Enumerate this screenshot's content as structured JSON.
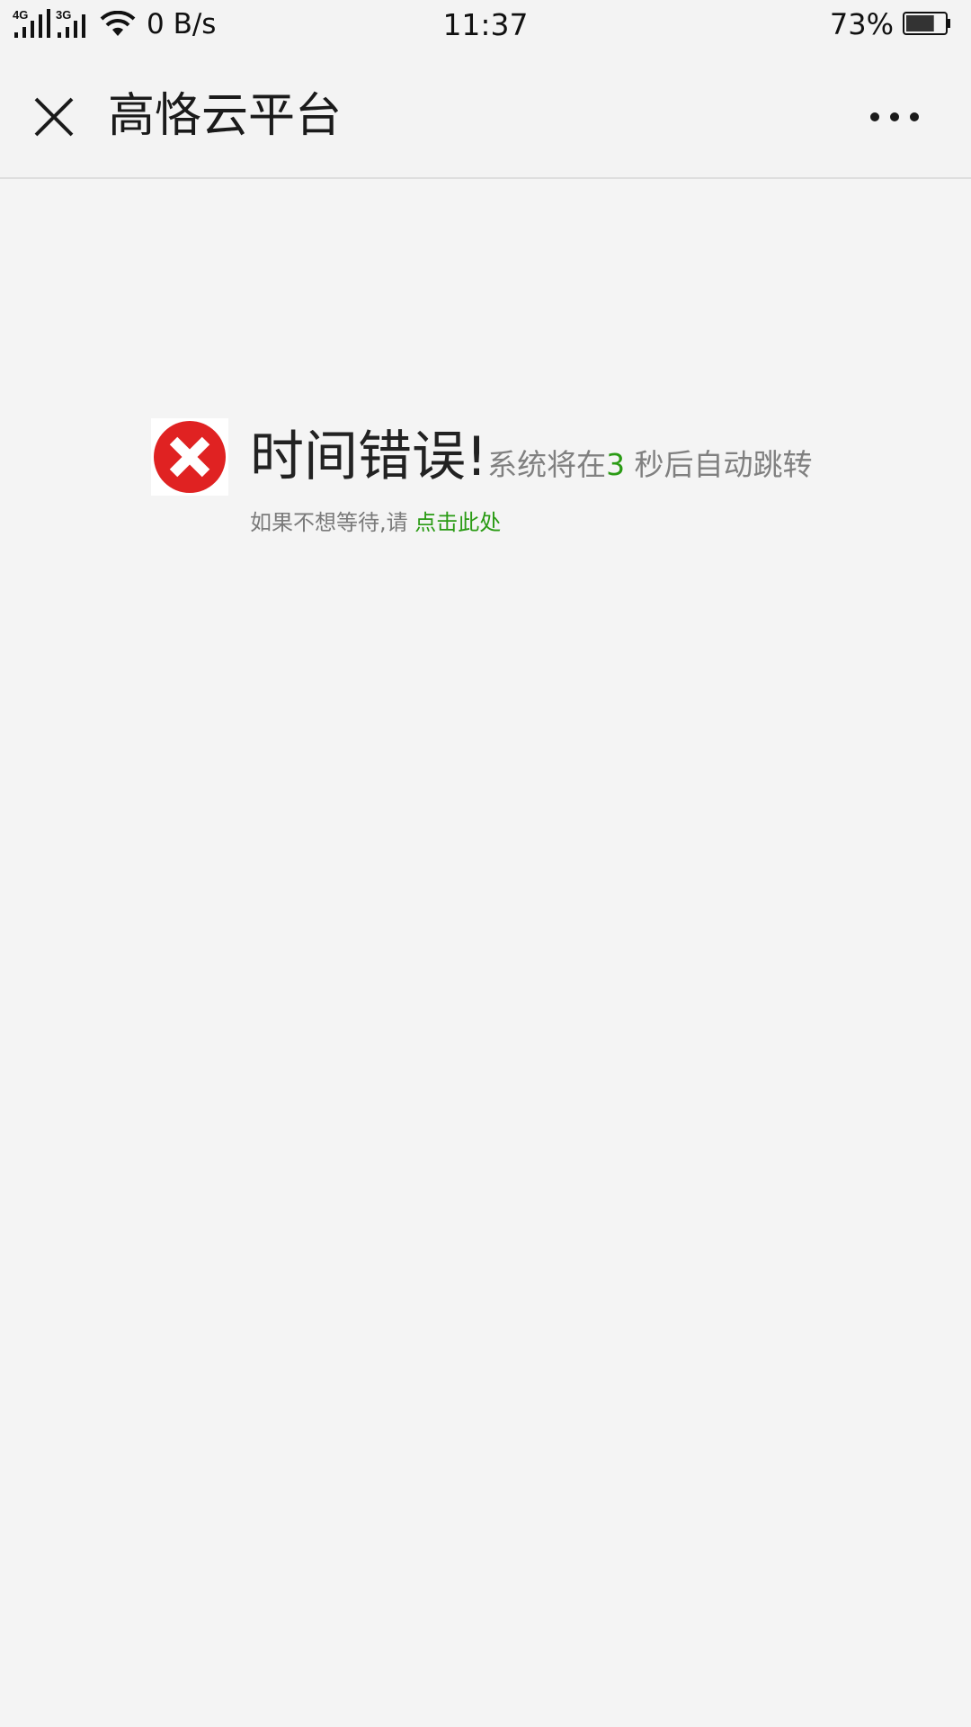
{
  "status_bar": {
    "network_label_1": "4G",
    "network_label_2": "3G",
    "net_speed": "0 B/s",
    "time": "11:37",
    "battery_percent": "73%",
    "battery_level": 0.73
  },
  "nav": {
    "title": "高恪云平台",
    "close_icon": "close-icon",
    "more_icon": "more-icon"
  },
  "content": {
    "icon": "error-x-icon",
    "error_title": "时间错误!",
    "sub_prefix": "系统将在",
    "countdown": "3",
    "sub_suffix": " 秒后自动跳转",
    "hint_prefix": "如果不想等待,请 ",
    "hint_link": "点击此处"
  },
  "colors": {
    "accent_green": "#2a9b14",
    "error_red": "#e02222",
    "background": "#f4f4f4"
  }
}
